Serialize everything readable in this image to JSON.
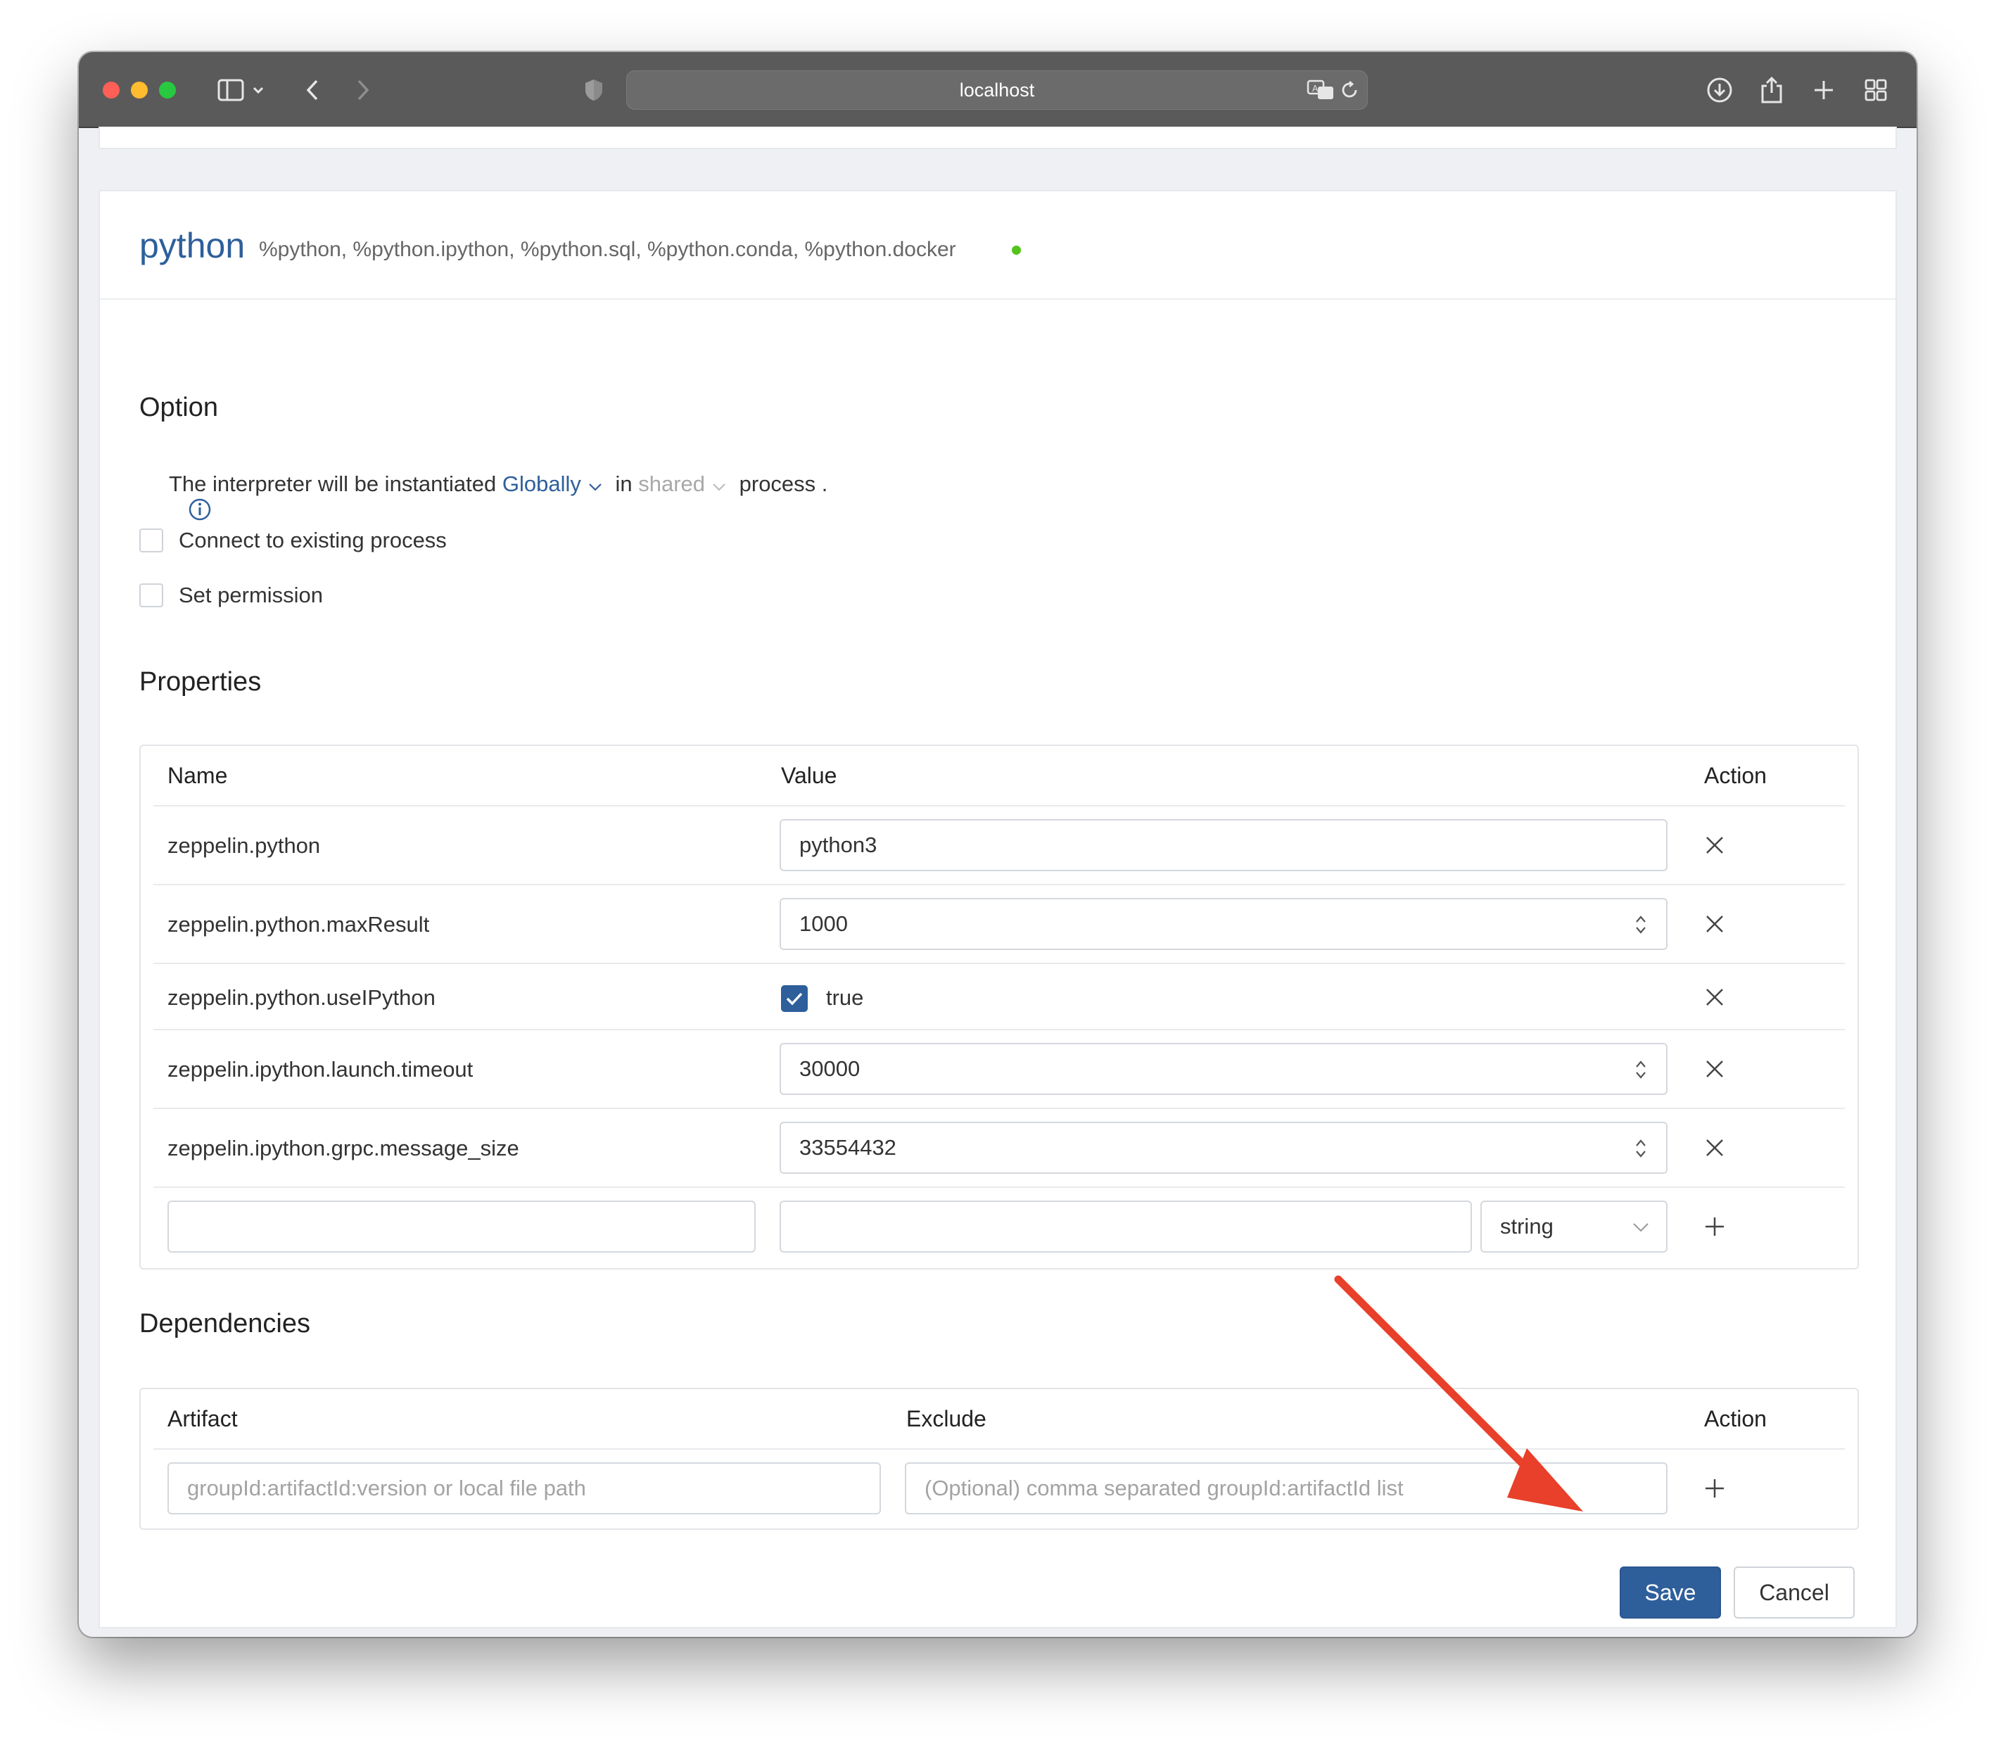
{
  "browser": {
    "url": "localhost"
  },
  "interpreter": {
    "name": "python",
    "aliases": "%python, %python.ipython, %python.sql, %python.conda, %python.docker",
    "status_color": "#52c41a"
  },
  "option": {
    "heading": "Option",
    "sentence_prefix": "The interpreter will be instantiated ",
    "scope_value": "Globally",
    "in_word": " in ",
    "mode_value": "shared",
    "sentence_suffix": " process .",
    "checkboxes": [
      {
        "label": "Connect to existing process",
        "checked": false
      },
      {
        "label": "Set permission",
        "checked": false
      }
    ]
  },
  "properties": {
    "heading": "Properties",
    "columns": {
      "name": "Name",
      "value": "Value",
      "action": "Action"
    },
    "rows": [
      {
        "name": "zeppelin.python",
        "value": "python3",
        "type": "text"
      },
      {
        "name": "zeppelin.python.maxResult",
        "value": "1000",
        "type": "number"
      },
      {
        "name": "zeppelin.python.useIPython",
        "value": "true",
        "type": "checkbox"
      },
      {
        "name": "zeppelin.ipython.launch.timeout",
        "value": "30000",
        "type": "number"
      },
      {
        "name": "zeppelin.ipython.grpc.message_size",
        "value": "33554432",
        "type": "number"
      }
    ],
    "new_row": {
      "name": "",
      "value": "",
      "type_select": "string"
    }
  },
  "dependencies": {
    "heading": "Dependencies",
    "columns": {
      "artifact": "Artifact",
      "exclude": "Exclude",
      "action": "Action"
    },
    "artifact_placeholder": "groupId:artifactId:version or local file path",
    "exclude_placeholder": "(Optional) comma separated groupId:artifactId list"
  },
  "buttons": {
    "save": "Save",
    "cancel": "Cancel"
  },
  "colors": {
    "accent": "#2e5f9b",
    "annotation_arrow": "#e8402a"
  }
}
